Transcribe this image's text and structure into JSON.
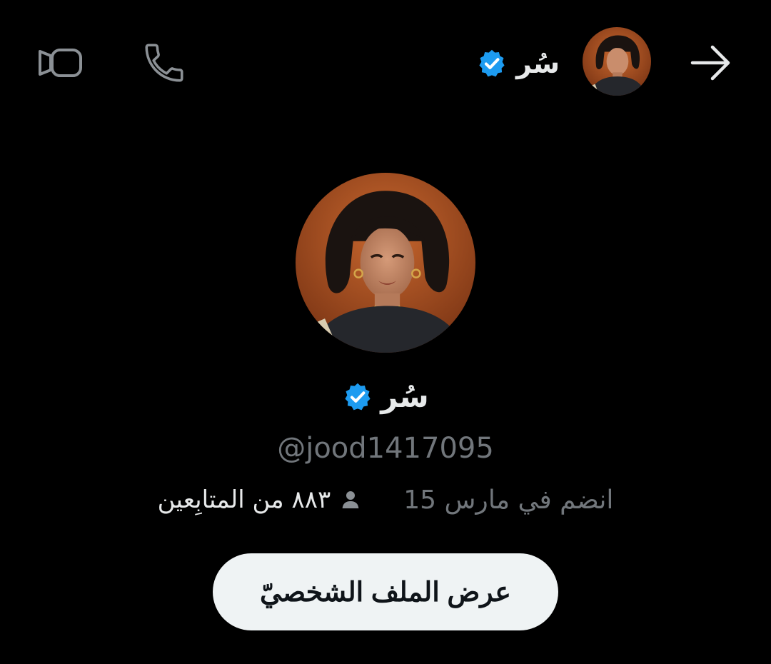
{
  "header": {
    "name": "سُر",
    "verified": true
  },
  "profile": {
    "display_name": "سُر",
    "handle": "@jood1417095",
    "joined": "انضم في مارس 15",
    "followers": "٨٨٣ من المتابِعين"
  },
  "actions": {
    "view_profile_label": "عرض الملف الشخصيّ"
  },
  "icons": {
    "back": "arrow-right-icon",
    "call": "phone-icon",
    "video": "video-camera-icon",
    "verified": "verified-badge-icon",
    "followers": "person-icon"
  },
  "colors": {
    "background": "#000000",
    "text_primary": "#e7e9ea",
    "text_secondary": "#71767b",
    "verified_blue": "#1d9bf0",
    "button_bg": "#eff3f4",
    "button_text": "#0f1419"
  }
}
